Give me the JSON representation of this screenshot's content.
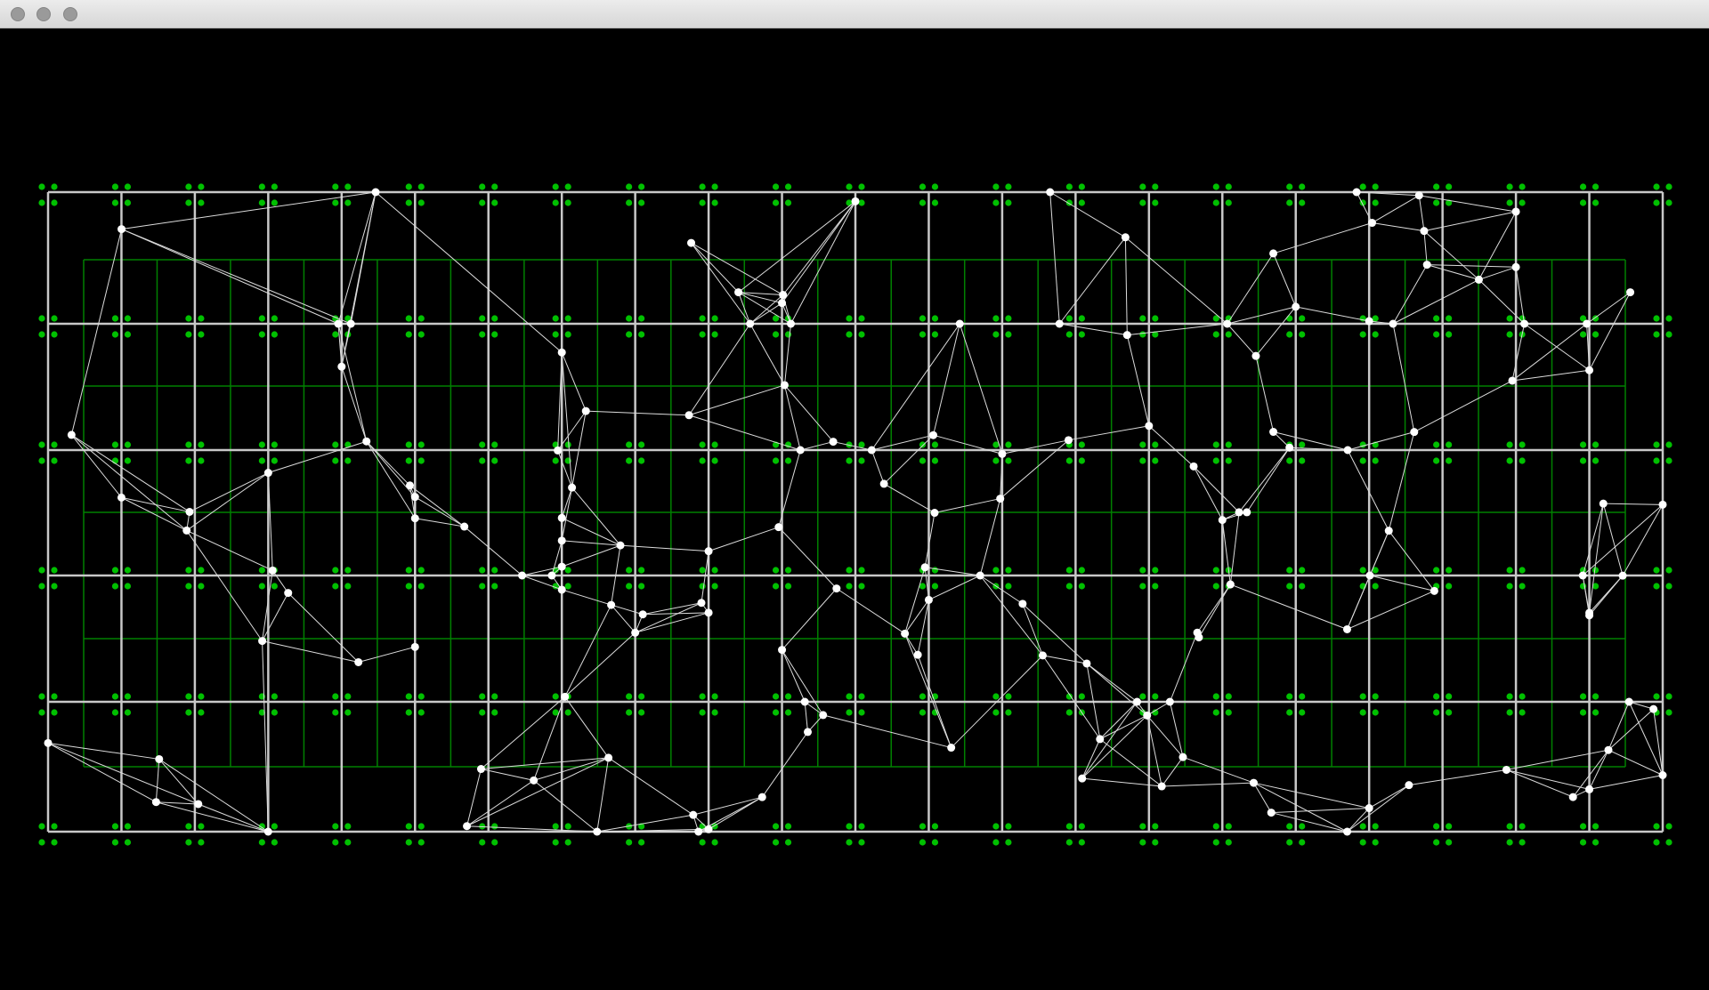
{
  "window": {
    "title": "",
    "controls": [
      "close",
      "minimize",
      "zoom"
    ]
  },
  "colors": {
    "background": "#000000",
    "titlebar": "#e3e3e3",
    "green_grid": "#008000",
    "green_points": "#00c000",
    "white_grid": "#c8c8c8",
    "nodes": "#ffffff",
    "edges": "#dcdcdc"
  }
}
